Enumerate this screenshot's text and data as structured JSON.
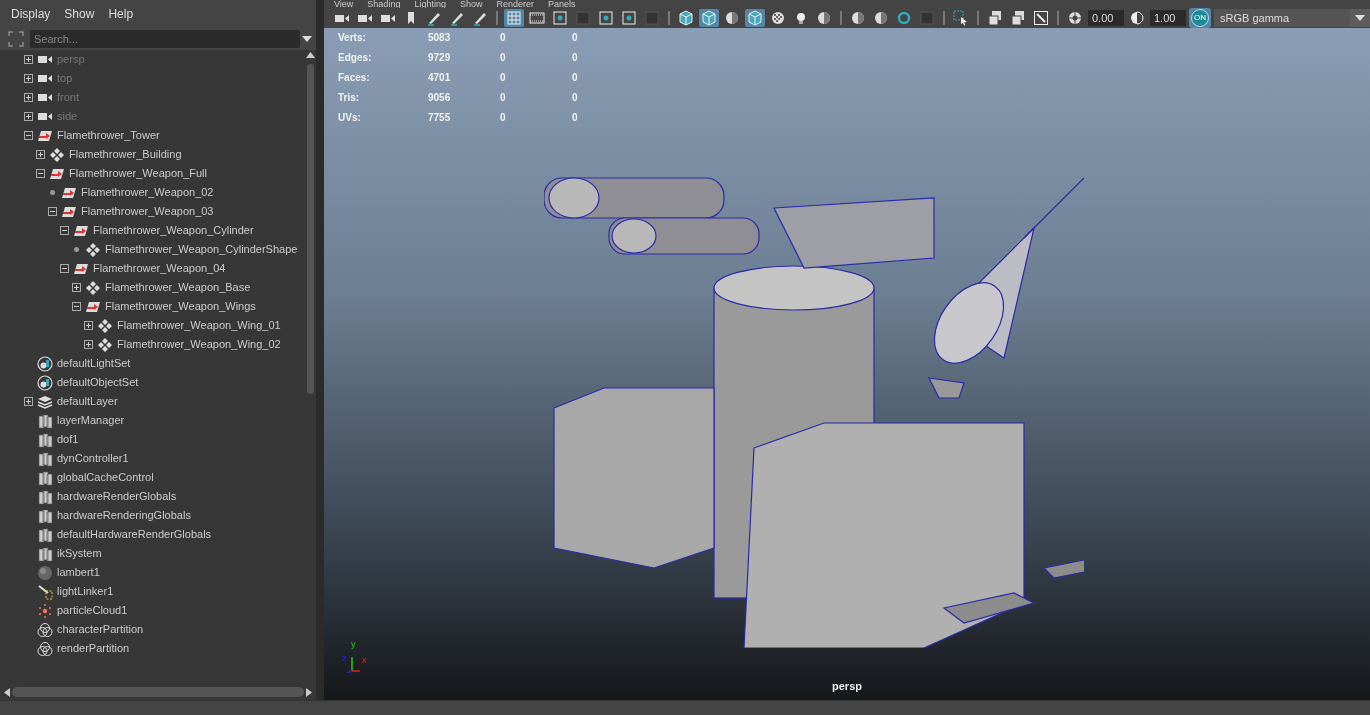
{
  "outliner": {
    "menu": [
      "Display",
      "Show",
      "Help"
    ],
    "search": {
      "placeholder": "Search..."
    },
    "items": [
      {
        "label": "persp",
        "kind": "camera",
        "dimmed": true,
        "expanded": false
      },
      {
        "label": "top",
        "kind": "camera",
        "dimmed": true,
        "expanded": false
      },
      {
        "label": "front",
        "kind": "camera",
        "dimmed": true,
        "expanded": false
      },
      {
        "label": "side",
        "kind": "camera",
        "dimmed": true,
        "expanded": false
      },
      {
        "label": "Flamethrower_Tower",
        "kind": "transform",
        "dimmed": false,
        "expanded": true,
        "children": [
          {
            "label": "Flamethrower_Building",
            "kind": "mesh",
            "dimmed": false,
            "expanded": false
          },
          {
            "label": "Flamethrower_Weapon_Full",
            "kind": "transform",
            "dimmed": false,
            "expanded": true,
            "children": [
              {
                "label": "Flamethrower_Weapon_02",
                "kind": "transform",
                "dimmed": false
              },
              {
                "label": "Flamethrower_Weapon_03",
                "kind": "transform",
                "dimmed": false,
                "expanded": true,
                "children": [
                  {
                    "label": "Flamethrower_Weapon_Cylinder",
                    "kind": "transform",
                    "dimmed": false,
                    "expanded": true,
                    "children": [
                      {
                        "label": "Flamethrower_Weapon_CylinderShape",
                        "kind": "mesh",
                        "dimmed": false
                      }
                    ]
                  },
                  {
                    "label": "Flamethrower_Weapon_04",
                    "kind": "transform",
                    "dimmed": false,
                    "expanded": true,
                    "children": [
                      {
                        "label": "Flamethrower_Weapon_Base",
                        "kind": "mesh",
                        "dimmed": false,
                        "expanded": false
                      },
                      {
                        "label": "Flamethrower_Weapon_Wings",
                        "kind": "transform",
                        "dimmed": false,
                        "expanded": true,
                        "children": [
                          {
                            "label": "Flamethrower_Weapon_Wing_01",
                            "kind": "mesh",
                            "dimmed": false,
                            "expanded": false
                          },
                          {
                            "label": "Flamethrower_Weapon_Wing_02",
                            "kind": "mesh",
                            "dimmed": false,
                            "expanded": false
                          }
                        ]
                      }
                    ]
                  }
                ]
              }
            ]
          }
        ]
      },
      {
        "label": "defaultLightSet",
        "kind": "set",
        "dimmed": false
      },
      {
        "label": "defaultObjectSet",
        "kind": "set",
        "dimmed": false
      },
      {
        "label": "defaultLayer",
        "kind": "layer",
        "dimmed": false,
        "expanded": false
      },
      {
        "label": "layerManager",
        "kind": "node",
        "dimmed": false
      },
      {
        "label": "dof1",
        "kind": "node",
        "dimmed": false
      },
      {
        "label": "dynController1",
        "kind": "node",
        "dimmed": false
      },
      {
        "label": "globalCacheControl",
        "kind": "node",
        "dimmed": false
      },
      {
        "label": "hardwareRenderGlobals",
        "kind": "node",
        "dimmed": false
      },
      {
        "label": "hardwareRenderingGlobals",
        "kind": "node",
        "dimmed": false
      },
      {
        "label": "defaultHardwareRenderGlobals",
        "kind": "node",
        "dimmed": false
      },
      {
        "label": "ikSystem",
        "kind": "node",
        "dimmed": false
      },
      {
        "label": "lambert1",
        "kind": "shader",
        "dimmed": false
      },
      {
        "label": "lightLinker1",
        "kind": "linker",
        "dimmed": false
      },
      {
        "label": "particleCloud1",
        "kind": "particle",
        "dimmed": false
      },
      {
        "label": "characterPartition",
        "kind": "partition",
        "dimmed": false
      },
      {
        "label": "renderPartition",
        "kind": "partition",
        "dimmed": false
      }
    ]
  },
  "viewport": {
    "menu": [
      "View",
      "Shading",
      "Lighting",
      "Show",
      "Renderer",
      "Panels"
    ],
    "toolbar": [
      {
        "kind": "camera",
        "selected": false
      },
      {
        "kind": "camera",
        "selected": false
      },
      {
        "kind": "camera",
        "selected": false
      },
      {
        "kind": "bookmark",
        "selected": false
      },
      {
        "kind": "pen",
        "selected": false
      },
      {
        "kind": "pen",
        "selected": false
      },
      {
        "kind": "pen",
        "selected": false
      },
      {
        "kind": "separator"
      },
      {
        "kind": "grid",
        "selected": true
      },
      {
        "kind": "film",
        "selected": false
      },
      {
        "kind": "square-dot",
        "selected": false
      },
      {
        "kind": "square",
        "selected": false
      },
      {
        "kind": "square-dot",
        "selected": false
      },
      {
        "kind": "square-dot",
        "selected": false
      },
      {
        "kind": "square",
        "selected": false
      },
      {
        "kind": "separator"
      },
      {
        "kind": "cube",
        "selected": false
      },
      {
        "kind": "cube",
        "selected": true
      },
      {
        "kind": "sphere",
        "selected": false
      },
      {
        "kind": "cube",
        "selected": true
      },
      {
        "kind": "checker",
        "selected": false
      },
      {
        "kind": "bulb",
        "selected": false
      },
      {
        "kind": "sphere",
        "selected": false
      },
      {
        "kind": "separator"
      },
      {
        "kind": "sphere",
        "selected": false
      },
      {
        "kind": "sphere",
        "selected": false
      },
      {
        "kind": "ring",
        "selected": false
      },
      {
        "kind": "square",
        "selected": false
      },
      {
        "kind": "separator"
      },
      {
        "kind": "cursor",
        "selected": false
      },
      {
        "kind": "separator"
      },
      {
        "kind": "layers",
        "selected": false
      },
      {
        "kind": "layers",
        "selected": false
      },
      {
        "kind": "image",
        "selected": false
      },
      {
        "kind": "separator"
      },
      {
        "kind": "aperture",
        "selected": false
      },
      {
        "kind": "field",
        "value": "0.00"
      },
      {
        "kind": "contrast",
        "selected": false
      },
      {
        "kind": "field",
        "value": "1.00"
      },
      {
        "kind": "toggle",
        "label": "ON",
        "selected": true
      },
      {
        "kind": "dropdown",
        "value": "sRGB gamma"
      }
    ],
    "stats": [
      {
        "label": "Verts:",
        "values": [
          "5083",
          "0",
          "0"
        ]
      },
      {
        "label": "Edges:",
        "values": [
          "9729",
          "0",
          "0"
        ]
      },
      {
        "label": "Faces:",
        "values": [
          "4701",
          "0",
          "0"
        ]
      },
      {
        "label": "Tris:",
        "values": [
          "9056",
          "0",
          "0"
        ]
      },
      {
        "label": "UVs:",
        "values": [
          "7755",
          "0",
          "0"
        ]
      }
    ],
    "axes": [
      "y",
      "z",
      "x"
    ],
    "camera_label": "persp"
  }
}
